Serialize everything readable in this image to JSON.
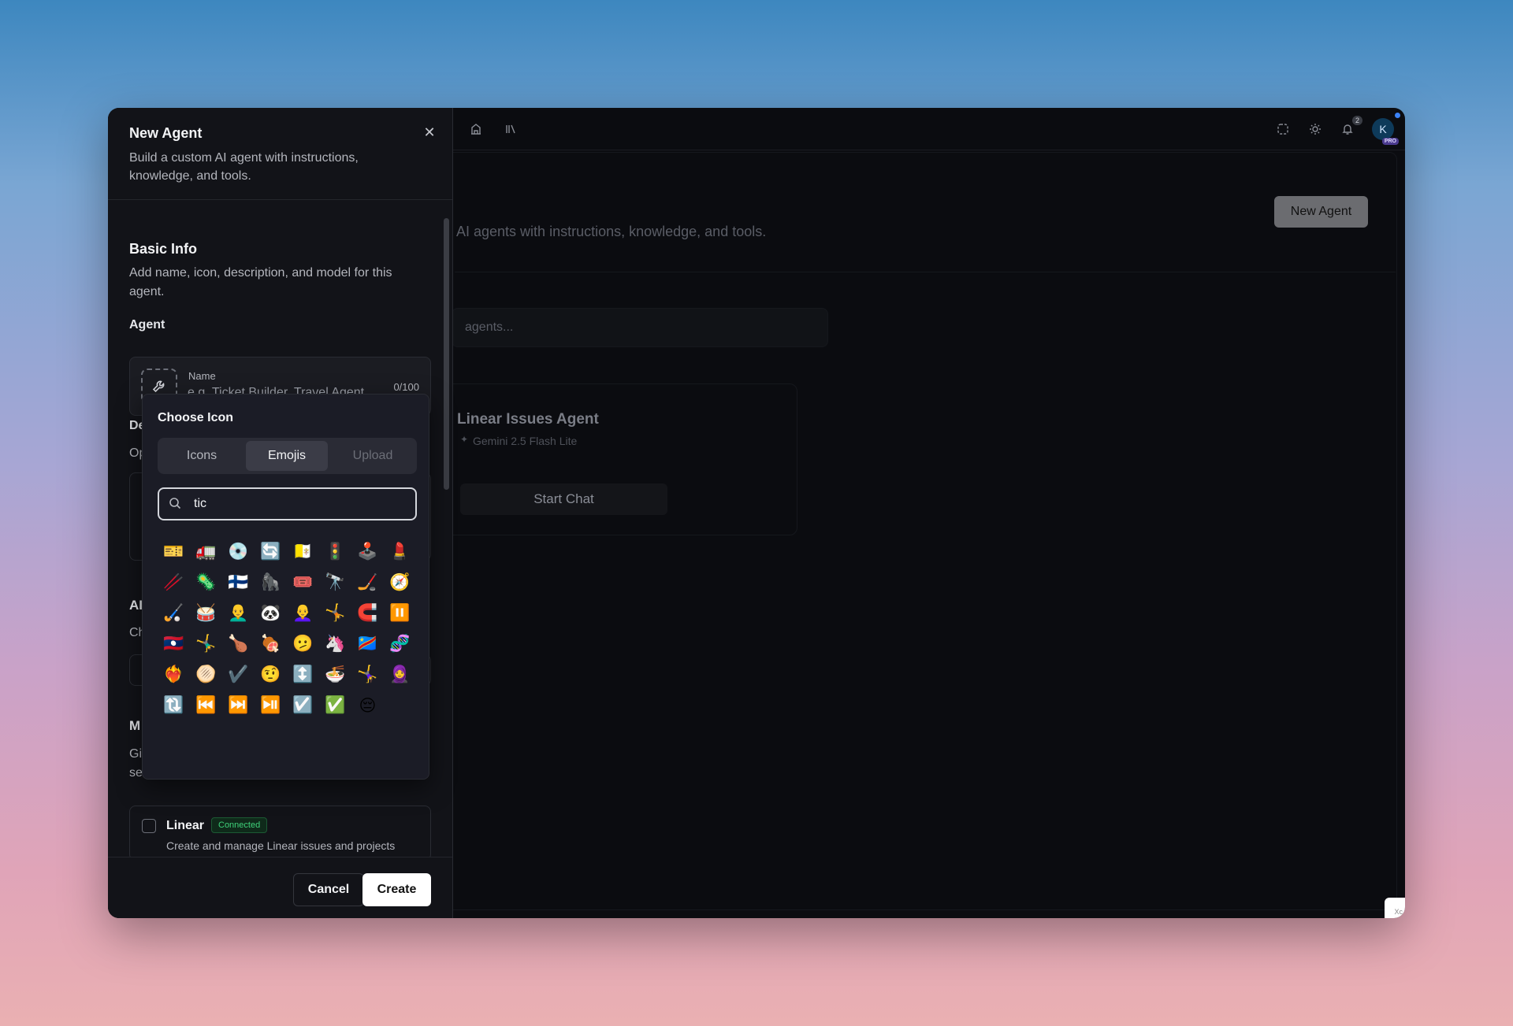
{
  "app": {
    "notification_count": "2",
    "avatar_initial": "K",
    "pro_label": "PRO",
    "new_agent_button": "New Agent",
    "page_subtitle_partial": "AI agents with instructions, knowledge, and tools.",
    "search_placeholder_partial": "agents...",
    "agent_card": {
      "title": "Linear Issues Agent",
      "model": "Gemini 2.5 Flash Lite",
      "action": "Start Chat"
    },
    "corner_chip": "Xc"
  },
  "panel": {
    "title": "New Agent",
    "description": "Build a custom AI agent with instructions, knowledge, and tools.",
    "basic_info_title": "Basic Info",
    "basic_info_desc": "Add name, icon, description, and model for this agent.",
    "agent_label": "Agent",
    "name_label": "Name",
    "name_placeholder": "e.g. Ticket Builder, Travel Agent",
    "char_count": "0/100",
    "partial_labels": [
      "De",
      "Op",
      "AI",
      "Ch",
      "M",
      "Gi",
      "se"
    ],
    "tool": {
      "name": "Linear",
      "status": "Connected",
      "description": "Create and manage Linear issues and projects"
    },
    "cancel": "Cancel",
    "create": "Create"
  },
  "picker": {
    "title": "Choose Icon",
    "tabs": [
      "Icons",
      "Emojis",
      "Upload"
    ],
    "active_tab": "Emojis",
    "search_value": "tic",
    "emojis": [
      "🎫",
      "🚛",
      "💿",
      "🔄",
      "🇻🇦",
      "🚦",
      "🕹️",
      "💄",
      "🥢",
      "🦠",
      "🇫🇮",
      "🦍",
      "🎟️",
      "🔭",
      "🏒",
      "🧭",
      "🏑",
      "🥁",
      "👨‍🦲",
      "🐼",
      "👩‍🦲",
      "🤸",
      "🧲",
      "⏸️",
      "🇱🇦",
      "🤸‍♂️",
      "🍗",
      "🍖",
      "🫤",
      "🦄",
      "🇨🇩",
      "🧬",
      "❤️‍🔥",
      "🫓",
      "✔️",
      "🤨",
      "↕️",
      "🍜",
      "🤸‍♀️",
      "🧕",
      "🔃",
      "⏮️",
      "⏭️",
      "⏯️",
      "☑️",
      "✅",
      "😔"
    ]
  },
  "colors": {
    "background_top": "#3d87bf",
    "background_bottom": "#eab0b2",
    "window_bg": "#0b0c10",
    "panel_bg": "#121318",
    "picker_bg": "#1b1c26",
    "connected_green": "#3fd27a"
  }
}
